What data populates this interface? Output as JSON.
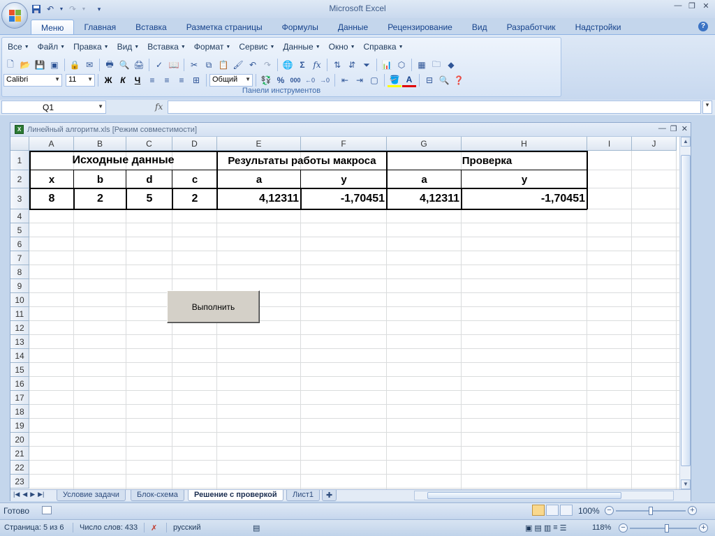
{
  "app": {
    "title": "Microsoft Excel",
    "accent": "#15428b"
  },
  "ribbon": {
    "tabs": [
      "Меню",
      "Главная",
      "Вставка",
      "Разметка страницы",
      "Формулы",
      "Данные",
      "Рецензирование",
      "Вид",
      "Разработчик",
      "Надстройки"
    ],
    "active_tab": "Меню",
    "menus": [
      "Все",
      "Файл",
      "Правка",
      "Вид",
      "Вставка",
      "Формат",
      "Сервис",
      "Данные",
      "Окно",
      "Справка"
    ],
    "font_name": "Calibri",
    "font_size": "11",
    "number_format": "Общий",
    "bold_label": "Ж",
    "italic_label": "К",
    "underline_label": "Ч",
    "percent_label": "%",
    "thousands_label": "000",
    "sum_label": "Σ",
    "fx_label": "fx",
    "group_label": "Панели инструментов"
  },
  "formula_bar": {
    "name_box": "Q1",
    "fx": "fx",
    "formula": ""
  },
  "workbook": {
    "title": "Линейный алгоритм.xls  [Режим совместимости]",
    "columns": [
      "A",
      "B",
      "C",
      "D",
      "E",
      "F",
      "G",
      "H",
      "I",
      "J"
    ],
    "rows": [
      "1",
      "2",
      "3",
      "4",
      "5",
      "6",
      "7",
      "8",
      "9",
      "10",
      "11",
      "12",
      "13",
      "14",
      "15",
      "16",
      "17",
      "18",
      "19",
      "20",
      "21",
      "22",
      "23"
    ],
    "cells": {
      "header_input": "Исходные данные",
      "header_results": "Результаты работы макроса",
      "header_check": "Проверка",
      "A2": "x",
      "B2": "b",
      "C2": "d",
      "D2": "c",
      "E2": "a",
      "F2": "y",
      "G2": "a",
      "H2": "y",
      "A3": "8",
      "B3": "2",
      "C3": "5",
      "D3": "2",
      "E3": "4,12311",
      "F3": "-1,70451",
      "G3": "4,12311",
      "H3": "-1,70451"
    },
    "run_button": "Выполнить",
    "sheet_tabs": [
      "Условие задачи",
      "Блок-схема",
      "Решение с проверкой",
      "Лист1"
    ],
    "active_sheet": "Решение с проверкой"
  },
  "status": {
    "ready": "Готово",
    "zoom": "100%"
  },
  "word_status": {
    "page": "Страница: 5 из 6",
    "words": "Число слов: 433",
    "language": "русский",
    "zoom": "118%"
  }
}
